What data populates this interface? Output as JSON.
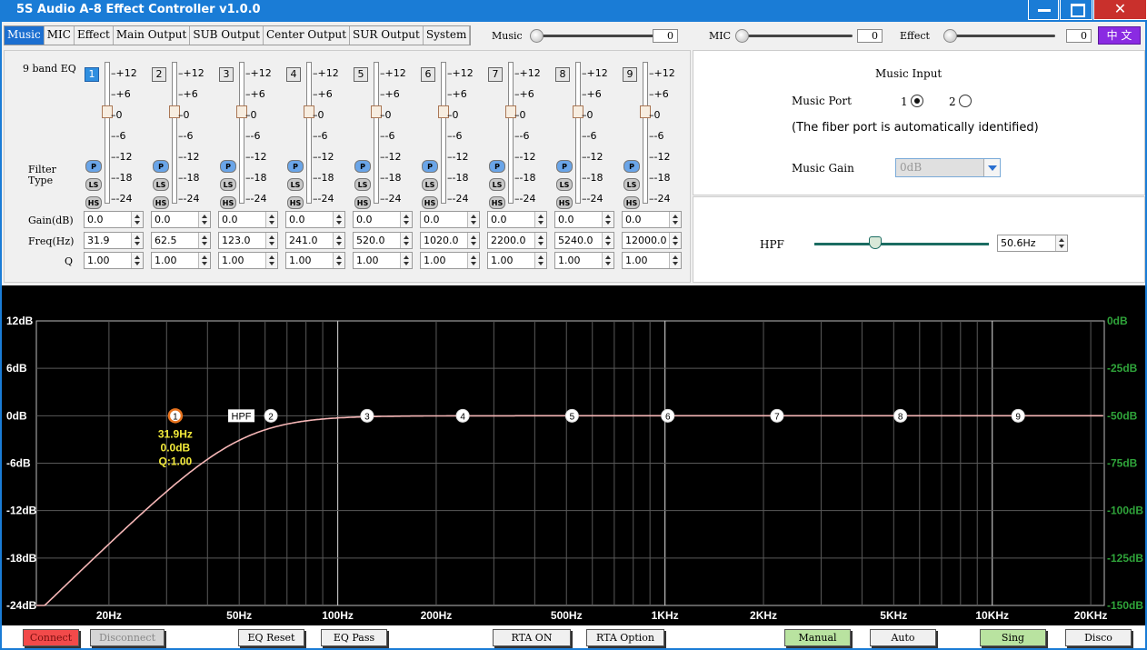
{
  "window": {
    "title": "5S Audio A-8 Effect Controller v1.0.0",
    "close_glyph": "✕"
  },
  "tabs": [
    "Music",
    "MIC",
    "Effect",
    "Main Output",
    "SUB Output",
    "Center Output",
    "SUR Output",
    "System"
  ],
  "active_tab": 0,
  "masters": [
    {
      "label": "Music",
      "value": "0",
      "level": 0
    },
    {
      "label": "MIC",
      "value": "0",
      "level": 0
    },
    {
      "label": "Effect",
      "value": "0",
      "level": 0
    }
  ],
  "lang_button": "中 文",
  "eq": {
    "title": "9 band EQ",
    "filter_type_label": [
      "Filter",
      "Type"
    ],
    "row_labels": {
      "gain": "Gain(dB)",
      "freq": "Freq(Hz)",
      "q": "Q"
    },
    "ticks": [
      "+12",
      "+6",
      "0",
      "-6",
      "-12",
      "-18",
      "-24"
    ],
    "filter_buttons": [
      "P",
      "LS",
      "HS"
    ],
    "selected_band": 0,
    "bands": [
      {
        "num": "1",
        "gain": "0.0",
        "freq": "31.9",
        "q": "1.00"
      },
      {
        "num": "2",
        "gain": "0.0",
        "freq": "62.5",
        "q": "1.00"
      },
      {
        "num": "3",
        "gain": "0.0",
        "freq": "123.0",
        "q": "1.00"
      },
      {
        "num": "4",
        "gain": "0.0",
        "freq": "241.0",
        "q": "1.00"
      },
      {
        "num": "5",
        "gain": "0.0",
        "freq": "520.0",
        "q": "1.00"
      },
      {
        "num": "6",
        "gain": "0.0",
        "freq": "1020.0",
        "q": "1.00"
      },
      {
        "num": "7",
        "gain": "0.0",
        "freq": "2200.0",
        "q": "1.00"
      },
      {
        "num": "8",
        "gain": "0.0",
        "freq": "5240.0",
        "q": "1.00"
      },
      {
        "num": "9",
        "gain": "0.0",
        "freq": "12000.0",
        "q": "1.00"
      }
    ]
  },
  "music_input": {
    "header": "Music Input",
    "port_label": "Music Port",
    "ports": [
      "1",
      "2"
    ],
    "selected_port": 0,
    "note": "(The fiber port is automatically identified)",
    "gain_label": "Music Gain",
    "gain_value": "0dB"
  },
  "hpf": {
    "label": "HPF",
    "value": "50.6Hz",
    "freq_hz": 50.6
  },
  "graph": {
    "left_labels": [
      "12dB",
      "6dB",
      "0dB",
      "-6dB",
      "-12dB",
      "-18dB",
      "-24dB"
    ],
    "right_labels": [
      "0dB",
      "-25dB",
      "-50dB",
      "-75dB",
      "-100dB",
      "-125dB",
      "-150dB"
    ],
    "x_labels": [
      {
        "f": 20,
        "t": "20Hz"
      },
      {
        "f": 50,
        "t": "50Hz"
      },
      {
        "f": 100,
        "t": "100Hz"
      },
      {
        "f": 200,
        "t": "200Hz"
      },
      {
        "f": 500,
        "t": "500Hz"
      },
      {
        "f": 1000,
        "t": "1KHz"
      },
      {
        "f": 2000,
        "t": "2KHz"
      },
      {
        "f": 5000,
        "t": "5KHz"
      },
      {
        "f": 10000,
        "t": "10KHz"
      },
      {
        "f": 20000,
        "t": "20KHz"
      }
    ],
    "hpf_tag": "HPF",
    "selected_info": [
      "31.9Hz",
      "0.0dB",
      "Q:1.00"
    ],
    "colors": {
      "left_axis": "#ffffff",
      "right_axis": "#2fa43a",
      "curve": "#f5b6b6",
      "info": "#f2e93a",
      "selected_ring": "#e8731e"
    }
  },
  "bottom": {
    "connect": "Connect",
    "disconnect": "Disconnect",
    "eq_reset": "EQ Reset",
    "eq_pass": "EQ Pass",
    "rta_on": "RTA ON",
    "rta_option": "RTA Option",
    "manual": "Manual",
    "auto": "Auto",
    "sing": "Sing",
    "disco": "Disco"
  }
}
